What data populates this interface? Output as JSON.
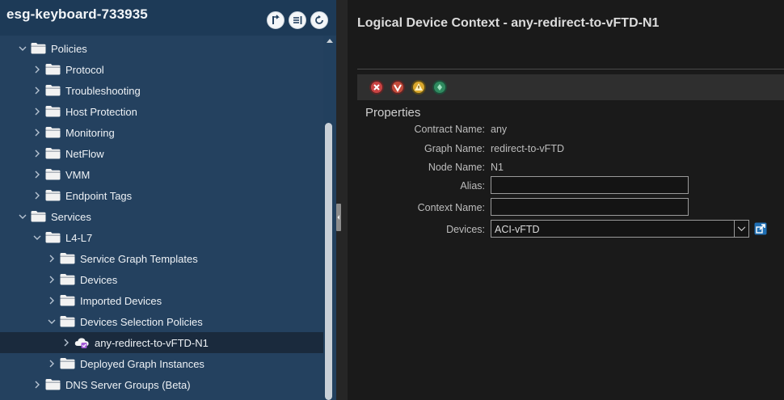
{
  "tree": {
    "title": "esg-keyboard-733935",
    "nodes": [
      {
        "label": "Policies",
        "level": 1,
        "expanded": true,
        "icon": "folder-icon"
      },
      {
        "label": "Protocol",
        "level": 2,
        "expanded": false,
        "icon": "folder-icon"
      },
      {
        "label": "Troubleshooting",
        "level": 2,
        "expanded": false,
        "icon": "folder-icon"
      },
      {
        "label": "Host Protection",
        "level": 2,
        "expanded": false,
        "icon": "folder-icon"
      },
      {
        "label": "Monitoring",
        "level": 2,
        "expanded": false,
        "icon": "folder-icon"
      },
      {
        "label": "NetFlow",
        "level": 2,
        "expanded": false,
        "icon": "folder-icon"
      },
      {
        "label": "VMM",
        "level": 2,
        "expanded": false,
        "icon": "folder-icon"
      },
      {
        "label": "Endpoint Tags",
        "level": 2,
        "expanded": false,
        "icon": "folder-icon"
      },
      {
        "label": "Services",
        "level": 1,
        "expanded": true,
        "icon": "folder-icon"
      },
      {
        "label": "L4-L7",
        "level": 2,
        "expanded": true,
        "icon": "folder-icon"
      },
      {
        "label": "Service Graph Templates",
        "level": 3,
        "expanded": false,
        "icon": "folder-icon"
      },
      {
        "label": "Devices",
        "level": 3,
        "expanded": false,
        "icon": "folder-icon"
      },
      {
        "label": "Imported Devices",
        "level": 3,
        "expanded": false,
        "icon": "folder-icon"
      },
      {
        "label": "Devices Selection Policies",
        "level": 3,
        "expanded": true,
        "icon": "folder-icon"
      },
      {
        "label": "any-redirect-to-vFTD-N1",
        "level": 4,
        "expanded": false,
        "icon": "cloud-policy-icon",
        "selected": true
      },
      {
        "label": "Deployed Graph Instances",
        "level": 3,
        "expanded": false,
        "icon": "folder-icon"
      },
      {
        "label": "DNS Server Groups (Beta)",
        "level": 2,
        "expanded": false,
        "icon": "folder-icon"
      }
    ]
  },
  "detail": {
    "title": "Logical Device Context - any-redirect-to-vFTD-N1",
    "faults": [
      "critical-fault-icon",
      "major-fault-icon",
      "minor-fault-icon",
      "warning-fault-icon"
    ],
    "properties_title": "Properties",
    "contract_name_label": "Contract Name:",
    "contract_name": "any",
    "graph_name_label": "Graph Name:",
    "graph_name": "redirect-to-vFTD",
    "node_name_label": "Node Name:",
    "node_name": "N1",
    "alias_label": "Alias:",
    "alias": "",
    "context_name_label": "Context Name:",
    "context_name": "",
    "devices_label": "Devices:",
    "devices": "ACI-vFTD"
  },
  "colors": {
    "tree_bg": "#24415f",
    "selected_row": "#1a2a3d",
    "detail_bg": "#1a1a1a",
    "link_blue": "#2f8fd8"
  }
}
